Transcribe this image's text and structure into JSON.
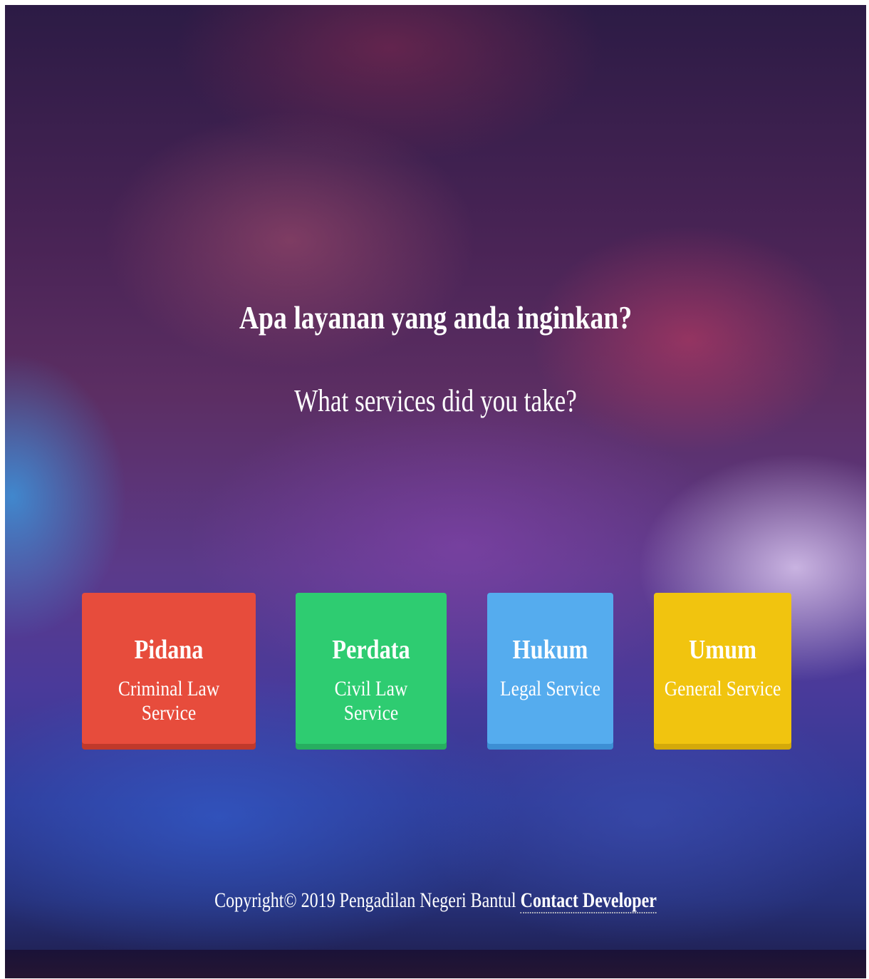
{
  "hero": {
    "heading": "Apa layanan yang anda inginkan?",
    "subheading": "What services did you take?"
  },
  "services": [
    {
      "title": "Pidana",
      "subtitle": "Criminal Law Service",
      "color": "#e74c3c"
    },
    {
      "title": "Perdata",
      "subtitle": "Civil Law Service",
      "color": "#2ecc71"
    },
    {
      "title": "Hukum",
      "subtitle": "Legal Service",
      "color": "#55acee"
    },
    {
      "title": "Umum",
      "subtitle": "General Service",
      "color": "#f1c40f"
    }
  ],
  "footer": {
    "copyright": "Copyright© 2019 Pengadilan Negeri Bantul",
    "contact_link": "Contact Developer"
  }
}
